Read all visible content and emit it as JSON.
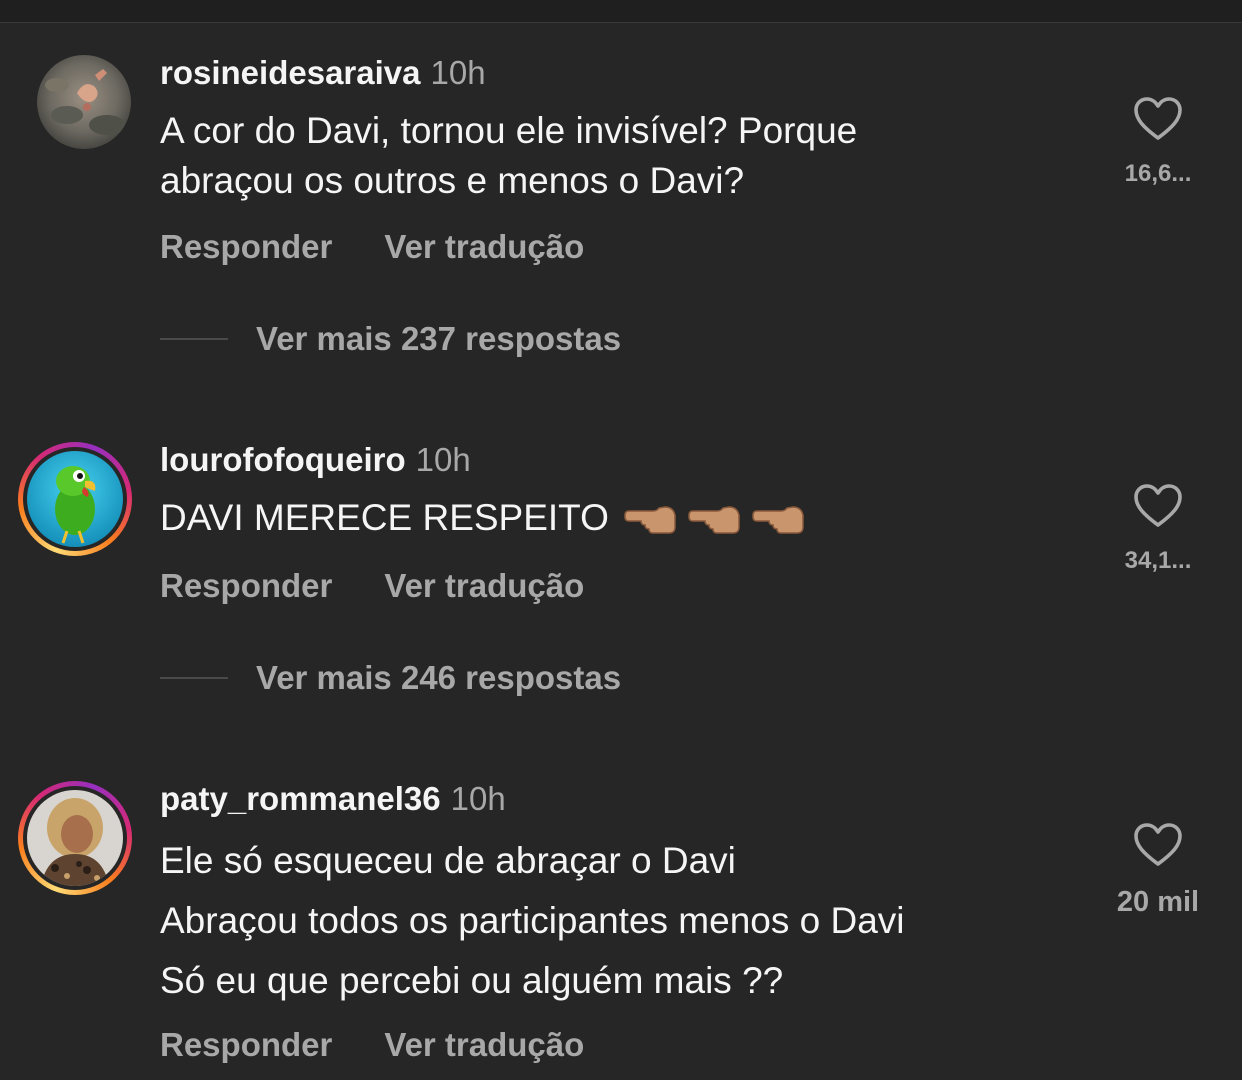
{
  "comments": [
    {
      "username": "rosineidesaraiva",
      "time": "10h",
      "lines": [
        "A cor do Davi, tornou ele invisível? Porque",
        "abraçou os outros e menos o Davi?"
      ],
      "reply_label": "Responder",
      "translate_label": "Ver tradução",
      "more_replies": "Ver mais 237 respostas",
      "likes": "16,6..."
    },
    {
      "username": "lourofofoqueiro",
      "time": "10h",
      "lines": [
        "DAVI MERECE RESPEITO"
      ],
      "reply_label": "Responder",
      "translate_label": "Ver tradução",
      "more_replies": "Ver mais 246 respostas",
      "likes": "34,1..."
    },
    {
      "username": "paty_rommanel36",
      "time": "10h",
      "lines": [
        "Ele só esqueceu de abraçar o Davi",
        "Abraçou todos os participantes menos o Davi",
        "Só eu que percebi ou alguém mais ??"
      ],
      "reply_label": "Responder",
      "translate_label": "Ver tradução",
      "likes": "20 mil"
    }
  ],
  "icons": {
    "like": "heart-outline-icon",
    "emoji": "backhand-index-pointing-left-emoji"
  },
  "colors": {
    "background": "#262626",
    "primary_text": "#f5f5f5",
    "secondary_text": "#a8a8a8"
  }
}
